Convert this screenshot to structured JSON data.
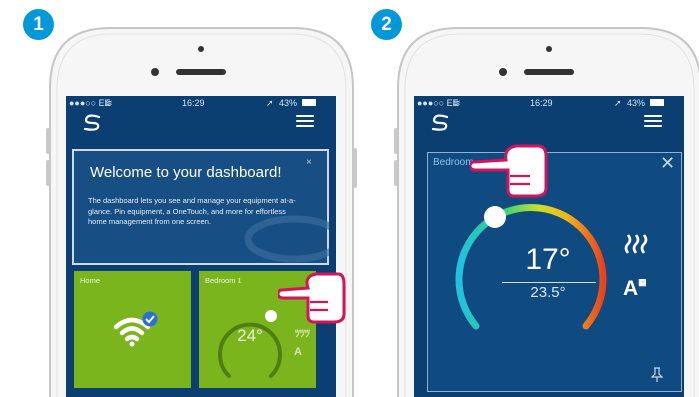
{
  "steps": {
    "step1": "1",
    "step2": "2"
  },
  "status_bar": {
    "carrier": "●●●○○ EE ",
    "time": "16:29",
    "battery": "43%"
  },
  "welcome_card": {
    "title": "Welcome to your dashboard!",
    "body": "The dashboard lets you see and manage your equipment at-a-glance. Pin equipment, a OneTouch, and more for effortless home management from one screen.",
    "close": "×"
  },
  "tiles": {
    "home": {
      "label": "Home"
    },
    "bedroom": {
      "label": "Bedroom 1",
      "temperature": "24°"
    }
  },
  "room_detail": {
    "label": "Bedroom",
    "set_temperature": "17°",
    "current_temperature": "23.5°",
    "close": "✕"
  },
  "colors": {
    "background": "#0b3f72",
    "tile_green": "#7ab51d",
    "badge_blue": "#0098d8",
    "hand_pink": "#d4145a"
  },
  "icons": [
    "app-logo-icon",
    "hamburger-menu-icon",
    "wifi-icon",
    "check-icon",
    "heating-icon",
    "auto-schedule-icon",
    "pin-icon",
    "pointing-hand-icon"
  ]
}
